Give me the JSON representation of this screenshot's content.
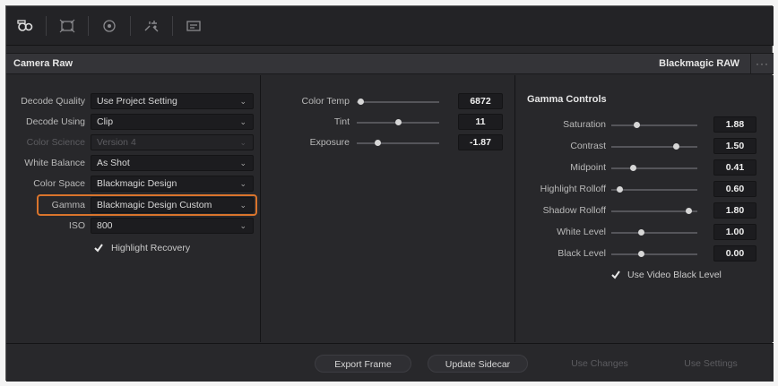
{
  "toolbar": {
    "icons": [
      "camera-raw-icon",
      "sizing-icon",
      "motion-effects-icon",
      "noise-reduction-icon",
      "image-stabilization-icon"
    ]
  },
  "header": {
    "title": "Camera Raw",
    "format": "Blackmagic RAW",
    "more": "···"
  },
  "decode": {
    "decode_quality": {
      "label": "Decode Quality",
      "value": "Use Project Setting"
    },
    "decode_using": {
      "label": "Decode Using",
      "value": "Clip"
    },
    "color_science": {
      "label": "Color Science",
      "value": "Version 4"
    },
    "white_balance": {
      "label": "White Balance",
      "value": "As Shot"
    },
    "color_space": {
      "label": "Color Space",
      "value": "Blackmagic Design"
    },
    "gamma": {
      "label": "Gamma",
      "value": "Blackmagic Design Custom"
    },
    "iso": {
      "label": "ISO",
      "value": "800"
    },
    "highlight_recovery": {
      "label": "Highlight Recovery",
      "checked": true
    }
  },
  "color": {
    "color_temp": {
      "label": "Color Temp",
      "value": "6872",
      "level": 0.05
    },
    "tint": {
      "label": "Tint",
      "value": "11",
      "level": 0.5
    },
    "exposure": {
      "label": "Exposure",
      "value": "-1.87",
      "level": 0.25
    }
  },
  "gamma_controls": {
    "title": "Gamma Controls",
    "saturation": {
      "label": "Saturation",
      "value": "1.88",
      "level": 0.3
    },
    "contrast": {
      "label": "Contrast",
      "value": "1.50",
      "level": 0.75
    },
    "midpoint": {
      "label": "Midpoint",
      "value": "0.41",
      "level": 0.25
    },
    "highlight_rolloff": {
      "label": "Highlight Rolloff",
      "value": "0.60",
      "level": 0.1
    },
    "shadow_rolloff": {
      "label": "Shadow Rolloff",
      "value": "1.80",
      "level": 0.9
    },
    "white_level": {
      "label": "White Level",
      "value": "1.00",
      "level": 0.35
    },
    "black_level": {
      "label": "Black Level",
      "value": "0.00",
      "level": 0.35
    },
    "use_video_black_level": {
      "label": "Use Video Black Level",
      "checked": true
    }
  },
  "footer": {
    "export_frame": "Export Frame",
    "update_sidecar": "Update Sidecar",
    "use_changes": "Use Changes",
    "use_settings": "Use Settings"
  },
  "colors": {
    "highlight": "#d9742c",
    "panel": "#28282b",
    "value_box": "#1c1c1f"
  }
}
